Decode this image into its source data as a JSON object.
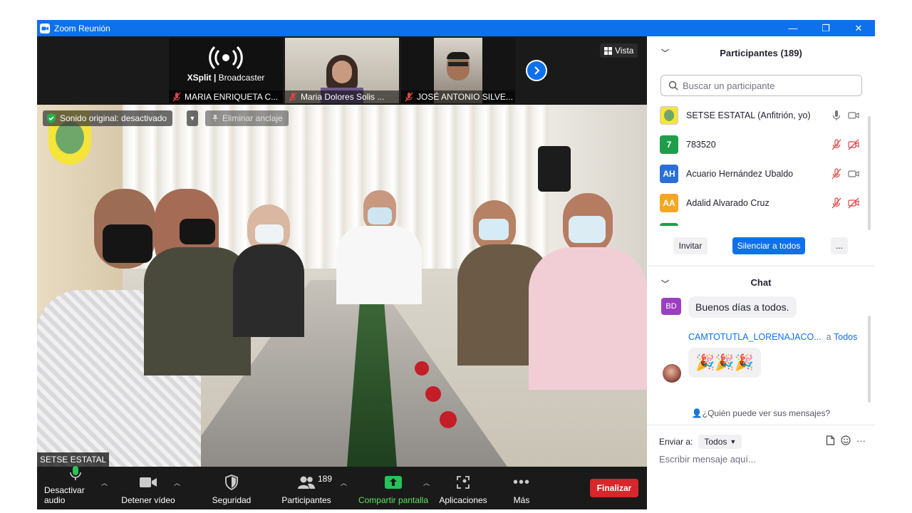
{
  "window": {
    "title": "Zoom Reunión"
  },
  "strip": {
    "thumbs": [
      {
        "name": "MARIA ENRIQUETA C...",
        "logo_line1": "XSplit",
        "logo_line2": "Broadcaster"
      },
      {
        "name": "Maria Dolores Solis ..."
      },
      {
        "name": "JOSÉ ANTONIO SILVE..."
      }
    ],
    "view_label": "Vista"
  },
  "main_video": {
    "sound_label": "Sonido original: desactivado",
    "unpin_label": "Eliminar anclaje",
    "speaker_name": "SETSE ESTATAL"
  },
  "toolbar": {
    "mute": "Desactivar audio",
    "video": "Detener vídeo",
    "security": "Seguridad",
    "participants": "Participantes",
    "participants_count": "189",
    "share": "Compartir pantalla",
    "apps": "Aplicaciones",
    "more": "Más",
    "end": "Finalizar"
  },
  "participants": {
    "header": "Participantes (189)",
    "search_placeholder": "Buscar un participante",
    "rows": [
      {
        "initials": "",
        "name": "SETSE ESTATAL (Anfitrión, yo)",
        "color": "#ffffff"
      },
      {
        "initials": "7",
        "name": "783520",
        "color": "#1e9e4a"
      },
      {
        "initials": "AH",
        "name": "Acuario Hernández Ubaldo",
        "color": "#2b6fd6"
      },
      {
        "initials": "AA",
        "name": "Adalid Alvarado Cruz",
        "color": "#f5a623"
      }
    ],
    "invite": "Invitar",
    "mute_all": "Silenciar a todos",
    "more": "..."
  },
  "chat": {
    "header": "Chat",
    "msg1_initials": "BD",
    "msg1_text": "Buenos días a todos.",
    "msg2_sender": "CAMTOTUTLA_LORENAJACO...",
    "msg2_to": "a",
    "msg2_recipient": "Todos",
    "msg2_text": "🎉🎉🎉",
    "who_can_see": "¿Quién puede ver sus mensajes?",
    "send_to_label": "Enviar a:",
    "send_to_value": "Todos",
    "input_placeholder": "Escribir mensaje aquí..."
  },
  "colors": {
    "accent": "#0e71eb",
    "end": "#d7272a",
    "share": "#5ee45e"
  }
}
